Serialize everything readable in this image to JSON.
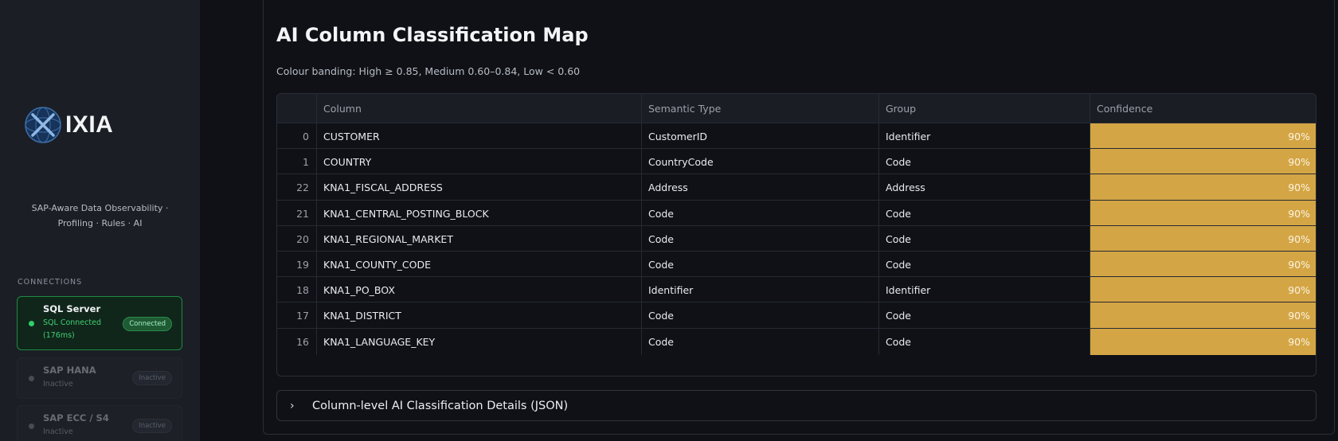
{
  "sidebar": {
    "logo_text": "IXIA",
    "tagline": "SAP-Aware Data Observability · Profiling · Rules · AI",
    "connections_label": "CONNECTIONS",
    "connections": [
      {
        "name": "SQL Server",
        "status_text": "SQL Connected (176ms)",
        "badge": "Connected"
      },
      {
        "name": "SAP HANA",
        "status_text": "Inactive",
        "badge": "Inactive"
      },
      {
        "name": "SAP ECC / S4",
        "status_text": "Inactive",
        "badge": "Inactive"
      }
    ]
  },
  "main": {
    "title": "AI Column Classification Map",
    "subtitle": "Colour banding: High ≥ 0.85, Medium 0.60–0.84, Low < 0.60",
    "table": {
      "headers": [
        "",
        "Column",
        "Semantic Type",
        "Group",
        "Confidence"
      ],
      "rows": [
        [
          "0",
          "CUSTOMER",
          "CustomerID",
          "Identifier",
          "90%"
        ],
        [
          "1",
          "COUNTRY",
          "CountryCode",
          "Code",
          "90%"
        ],
        [
          "22",
          "KNA1_FISCAL_ADDRESS",
          "Address",
          "Address",
          "90%"
        ],
        [
          "21",
          "KNA1_CENTRAL_POSTING_BLOCK",
          "Code",
          "Code",
          "90%"
        ],
        [
          "20",
          "KNA1_REGIONAL_MARKET",
          "Code",
          "Code",
          "90%"
        ],
        [
          "19",
          "KNA1_COUNTY_CODE",
          "Code",
          "Code",
          "90%"
        ],
        [
          "18",
          "KNA1_PO_BOX",
          "Identifier",
          "Identifier",
          "90%"
        ],
        [
          "17",
          "KNA1_DISTRICT",
          "Code",
          "Code",
          "90%"
        ],
        [
          "16",
          "KNA1_LANGUAGE_KEY",
          "Code",
          "Code",
          "90%"
        ]
      ]
    },
    "expander_label": "Column-level AI Classification Details (JSON)"
  },
  "colors": {
    "high_confidence": "#d4a544",
    "connected": "#2fd06b",
    "sidebar_bg": "#1b1e25",
    "main_bg": "#0f1116"
  }
}
